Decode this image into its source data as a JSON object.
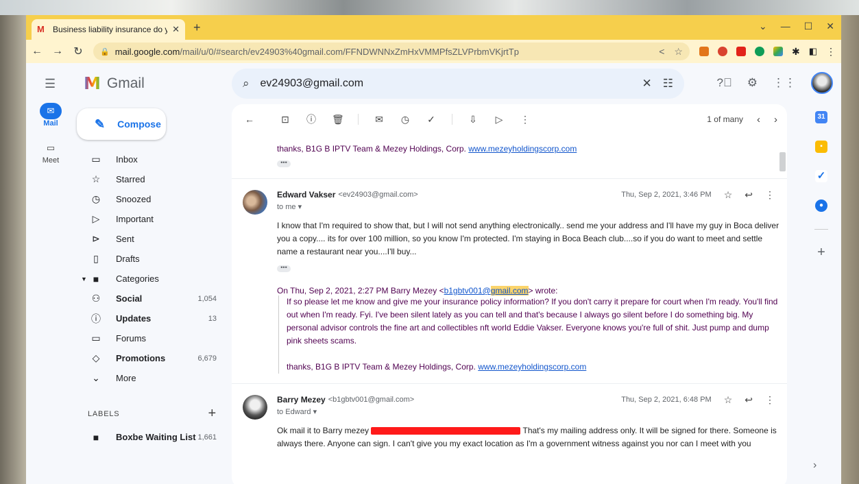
{
  "browser": {
    "tab_title": "Business liability insurance do y",
    "url_domain": "mail.google.com",
    "url_path": "/mail/u/0/#search/ev24903%40gmail.com/FFNDWNNxZmHxVMMPfsZLVPrbmVKjrtTp"
  },
  "gmail": {
    "logo_text": "Gmail",
    "search_value": "ev24903@gmail.com"
  },
  "rail": [
    {
      "label": "Mail",
      "icon": "mail-icon"
    },
    {
      "label": "Meet",
      "icon": "video-icon"
    }
  ],
  "compose_label": "Compose",
  "nav": [
    {
      "label": "Inbox",
      "icon": "inbox-icon",
      "count": ""
    },
    {
      "label": "Starred",
      "icon": "star-icon",
      "count": ""
    },
    {
      "label": "Snoozed",
      "icon": "clock-icon",
      "count": ""
    },
    {
      "label": "Important",
      "icon": "important-icon",
      "count": ""
    },
    {
      "label": "Sent",
      "icon": "send-icon",
      "count": ""
    },
    {
      "label": "Drafts",
      "icon": "draft-icon",
      "count": ""
    },
    {
      "label": "Categories",
      "icon": "label-icon",
      "count": ""
    },
    {
      "label": "Social",
      "icon": "people-icon",
      "count": "1,054"
    },
    {
      "label": "Updates",
      "icon": "info-icon",
      "count": "13"
    },
    {
      "label": "Forums",
      "icon": "forum-icon",
      "count": ""
    },
    {
      "label": "Promotions",
      "icon": "tag-icon",
      "count": "6,679"
    },
    {
      "label": "More",
      "icon": "chevron-down-icon",
      "count": ""
    }
  ],
  "labels": {
    "heading": "LABELS",
    "items": [
      {
        "label": "Boxbe Waiting List",
        "count": "1,661"
      }
    ]
  },
  "pager": "1 of many",
  "messages": {
    "collapsed_text": "thanks, B1G B IPTV Team & Mezey Holdings, Corp.",
    "collapsed_link": "www.mezeyholdingscorp.com",
    "first": {
      "sender": "Edward Vakser",
      "email": "<ev24903@gmail.com>",
      "date": "Thu, Sep 2, 2021, 3:46 PM",
      "to": "to me ▾",
      "body": "I know that I'm required to show that, but I will not send anything electronically.. send me your address and I'll have my guy in Boca deliver you a copy.... its for over 100 million, so you know I'm protected. I'm staying in Boca Beach club....so if you do want to meet and settle name a restaurant near you....I'll buy...",
      "quote_prefix": "On Thu, Sep 2, 2021, 2:27 PM Barry Mezey <",
      "quote_email_a": "b1gbtv001@",
      "quote_email_b": "gmail.com",
      "quote_suffix": "> wrote:",
      "quote_body": "If so please let me know and give me your insurance policy information? If you don't carry it prepare for court when I'm ready. You'll find out when I'm ready. Fyi. I've been silent lately as you can tell and that's because I always go silent before I do something big. My personal advisor controls the fine art and collectibles nft world Eddie Vakser. Everyone knows you're full of shit. Just pump and dump pink sheets scams.",
      "quote_sig": "thanks, B1G B IPTV Team & Mezey Holdings, Corp.",
      "quote_link": "www.mezeyholdingscorp.com"
    },
    "second": {
      "sender": "Barry Mezey",
      "email": "<b1gbtv001@gmail.com>",
      "date": "Thu, Sep 2, 2021, 6:48 PM",
      "to": "to Edward ▾",
      "body_a": "Ok mail it to Barry mezey",
      "body_b": "That's my mailing address only. It will be signed for there. Someone is always there. Anyone can sign. I can't give you my exact location as I'm a government witness against you nor can I meet with you"
    }
  },
  "colors": {
    "accent": "#1a73e8",
    "tab_bar": "#f6cf4c",
    "quote_text": "#500050"
  }
}
